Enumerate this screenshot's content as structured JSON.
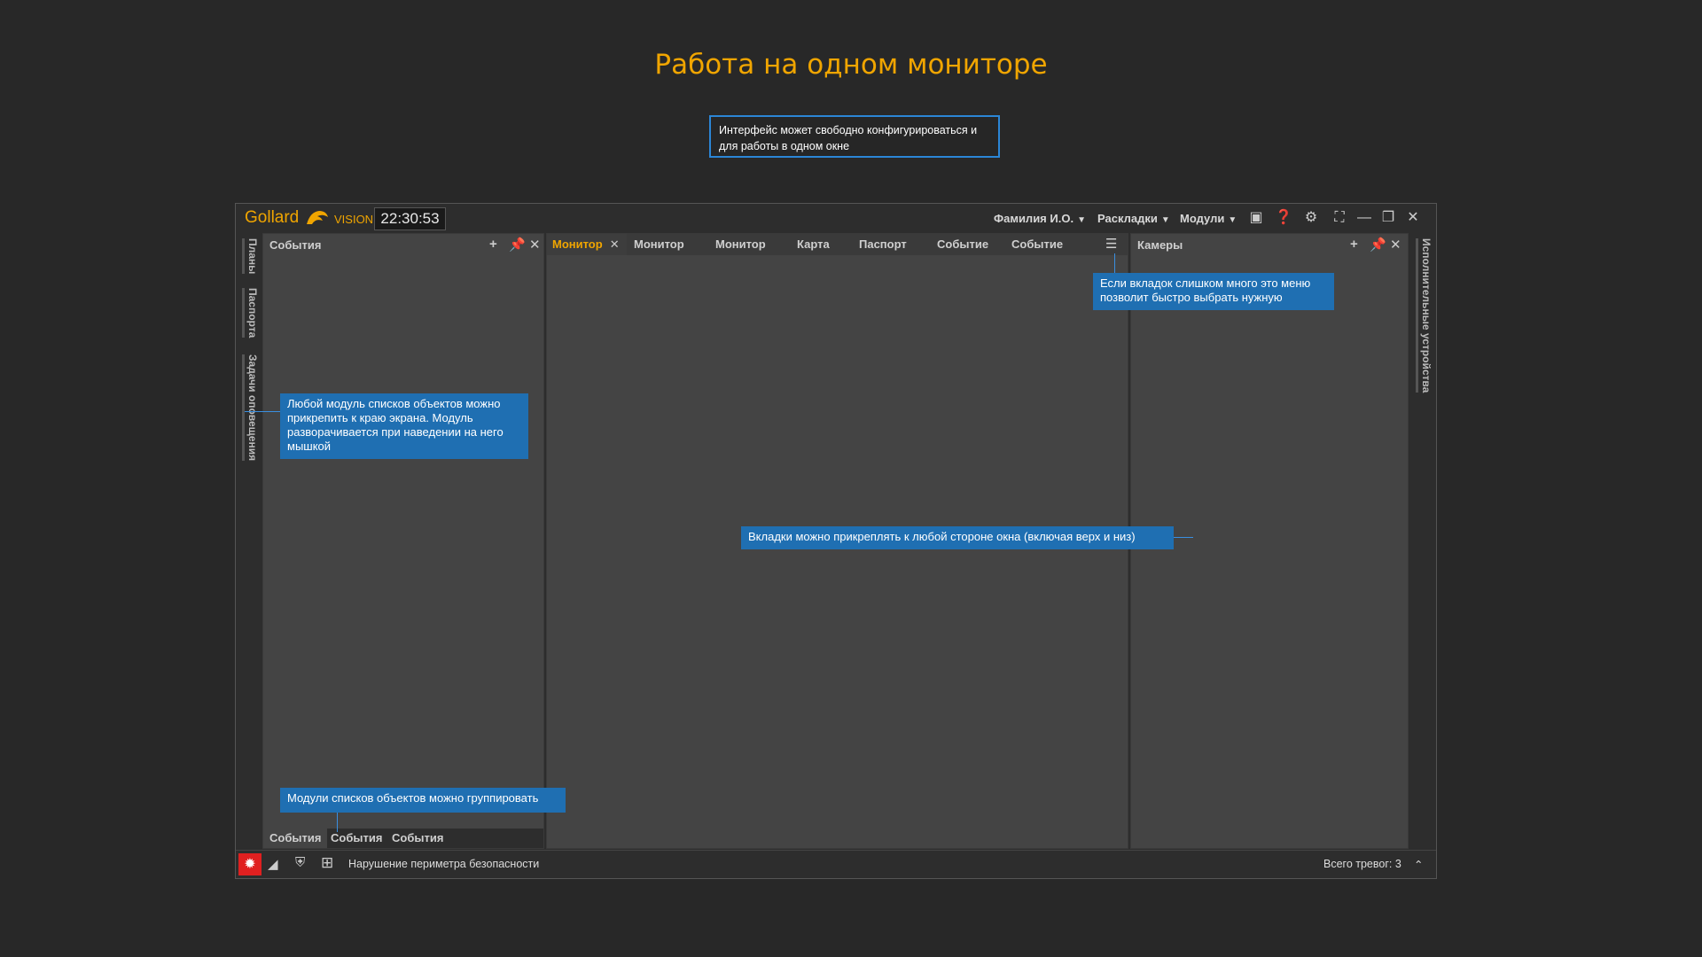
{
  "page": {
    "title": "Работа на одном мониторе",
    "intro": "Интерфейс может свободно конфигурироваться и для работы в одном окне"
  },
  "app": {
    "logo_text": "Gollard",
    "logo_sub": "VISION",
    "clock": "22:30:53",
    "menu": [
      "Фамилия И.О.",
      "Раскладки",
      "Модули"
    ],
    "left_rail_tabs": [
      "Планы",
      "Паспорта",
      "Задачи оповещения"
    ],
    "right_rail_tabs": [
      "Исполнительные устройства"
    ],
    "left_panel": {
      "title": "События",
      "bottom_tabs": [
        "События",
        "События",
        "События"
      ]
    },
    "center_tabs": [
      "Монитор",
      "Монитор",
      "Монитор",
      "Карта",
      "Паспорт",
      "Событие",
      "Событие"
    ],
    "right_panel": {
      "title": "Камеры"
    },
    "status": {
      "message": "Нарушение периметра безопасности",
      "alarm_count": "Всего тревог: 3"
    }
  },
  "callouts": {
    "tabs_menu": "Если вкладок слишком много это меню позволит быстро выбрать нужную",
    "pin_modules": "Любой модуль списков объектов можно прикрепить к краю экрана. Модуль разворачивается при наведении на него мышкой",
    "dock_tabs": "Вкладки можно прикреплять к любой стороне окна (включая верх и низ)",
    "group_modules": "Модули списков объектов можно группировать"
  },
  "colors": {
    "accent": "#f0a500",
    "callout": "#1f6fb2",
    "alarm": "#e02020"
  }
}
